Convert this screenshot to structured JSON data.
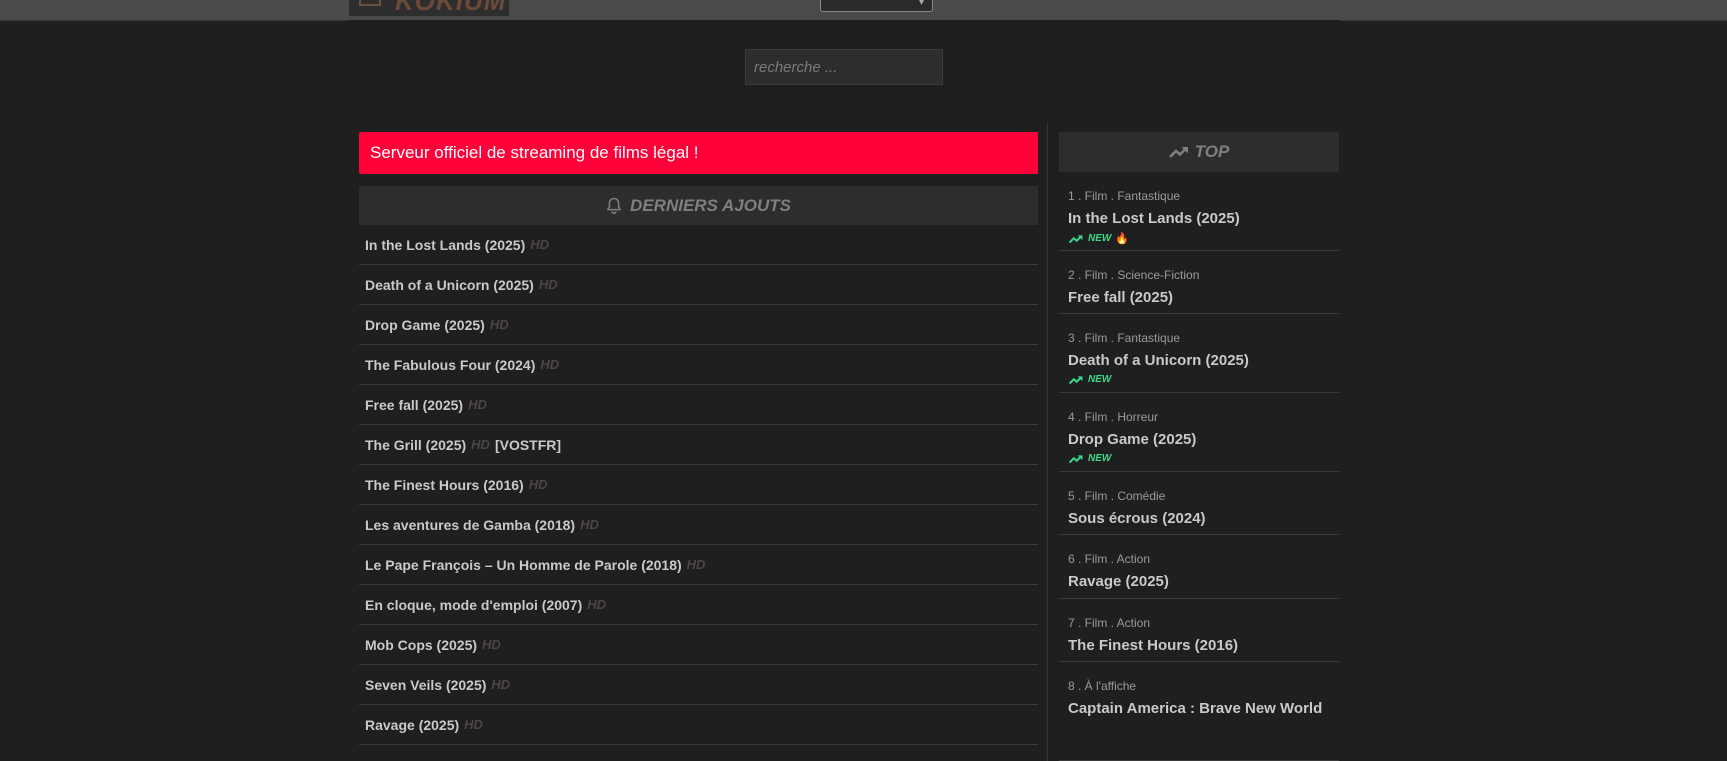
{
  "header": {
    "logo_text": "KOKIUM"
  },
  "search": {
    "placeholder": "recherche ..."
  },
  "banner": {
    "text": "Serveur officiel de streaming de films légal !"
  },
  "latest": {
    "heading": "DERNIERS AJOUTS",
    "items": [
      {
        "title": "In the Lost Lands (2025)",
        "quality": "HD",
        "tag": ""
      },
      {
        "title": "Death of a Unicorn (2025)",
        "quality": "HD",
        "tag": ""
      },
      {
        "title": "Drop Game (2025)",
        "quality": "HD",
        "tag": ""
      },
      {
        "title": "The Fabulous Four (2024)",
        "quality": "HD",
        "tag": ""
      },
      {
        "title": "Free fall (2025)",
        "quality": "HD",
        "tag": ""
      },
      {
        "title": "The Grill (2025)",
        "quality": "HD",
        "tag": "[VOSTFR]"
      },
      {
        "title": "The Finest Hours (2016)",
        "quality": "HD",
        "tag": ""
      },
      {
        "title": "Les aventures de Gamba (2018)",
        "quality": "HD",
        "tag": ""
      },
      {
        "title": "Le Pape François – Un Homme de Parole (2018)",
        "quality": "HD",
        "tag": ""
      },
      {
        "title": "En cloque, mode d'emploi (2007)",
        "quality": "HD",
        "tag": ""
      },
      {
        "title": "Mob Cops (2025)",
        "quality": "HD",
        "tag": ""
      },
      {
        "title": "Seven Veils (2025)",
        "quality": "HD",
        "tag": ""
      },
      {
        "title": "Ravage (2025)",
        "quality": "HD",
        "tag": ""
      }
    ]
  },
  "top": {
    "heading": "TOP",
    "items": [
      {
        "meta": "1 . Film . Fantastique",
        "title": "In the Lost Lands (2025)",
        "badge": "NEW",
        "fire": true
      },
      {
        "meta": "2 . Film . Science-Fiction",
        "title": "Free fall (2025)",
        "badge": "",
        "fire": false
      },
      {
        "meta": "3 . Film . Fantastique",
        "title": "Death of a Unicorn (2025)",
        "badge": "NEW",
        "fire": false
      },
      {
        "meta": "4 . Film . Horreur",
        "title": "Drop Game (2025)",
        "badge": "NEW",
        "fire": false
      },
      {
        "meta": "5 . Film . Comédie",
        "title": "Sous écrous (2024)",
        "badge": "",
        "fire": false
      },
      {
        "meta": "6 . Film . Action",
        "title": "Ravage (2025)",
        "badge": "",
        "fire": false
      },
      {
        "meta": "7 . Film . Action",
        "title": "The Finest Hours (2016)",
        "badge": "",
        "fire": false
      },
      {
        "meta": "8 . À l'affiche",
        "title": "Captain America : Brave New World",
        "badge": "",
        "fire": false
      }
    ]
  },
  "icons": {
    "bell": "bell-icon",
    "trending": "trending-up-icon",
    "fire": "fire-icon"
  },
  "colors": {
    "banner": "#ff0039",
    "new_badge": "#39d98a"
  }
}
